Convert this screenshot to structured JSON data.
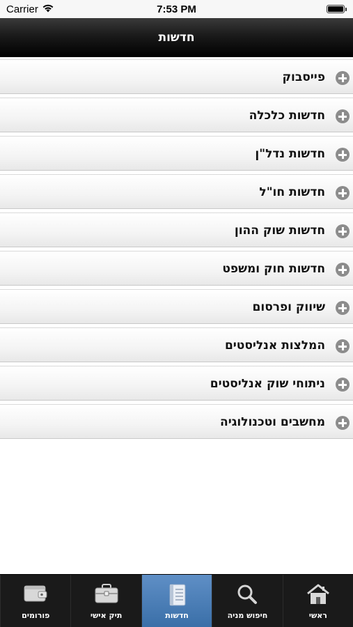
{
  "status_bar": {
    "carrier": "Carrier",
    "time": "7:53 PM"
  },
  "header": {
    "title": "חדשות"
  },
  "categories": [
    {
      "label": "פייסבוק"
    },
    {
      "label": "חדשות כלכלה"
    },
    {
      "label": "חדשות נדל\"ן"
    },
    {
      "label": "חדשות חו\"ל"
    },
    {
      "label": "חדשות שוק ההון"
    },
    {
      "label": "חדשות חוק ומשפט"
    },
    {
      "label": "שיווק ופרסום"
    },
    {
      "label": "המלצות אנליסטים"
    },
    {
      "label": "ניתוחי שוק אנליסטים"
    },
    {
      "label": "מחשבים וטכנולוגיה"
    }
  ],
  "tab_bar": {
    "active": "news",
    "tabs": [
      {
        "id": "forums",
        "label": "פורומים",
        "icon": "wallet-icon"
      },
      {
        "id": "portfolio",
        "label": "תיק אישי",
        "icon": "briefcase-icon"
      },
      {
        "id": "news",
        "label": "חדשות",
        "icon": "notebook-icon"
      },
      {
        "id": "stock_search",
        "label": "חיפוש מניה",
        "icon": "magnifier-icon"
      },
      {
        "id": "home",
        "label": "ראשי",
        "icon": "home-icon"
      }
    ]
  },
  "colors": {
    "header_bg": "#000000",
    "tab_active": "#4a7fbb",
    "plus_icon": "#8c8c8c"
  }
}
